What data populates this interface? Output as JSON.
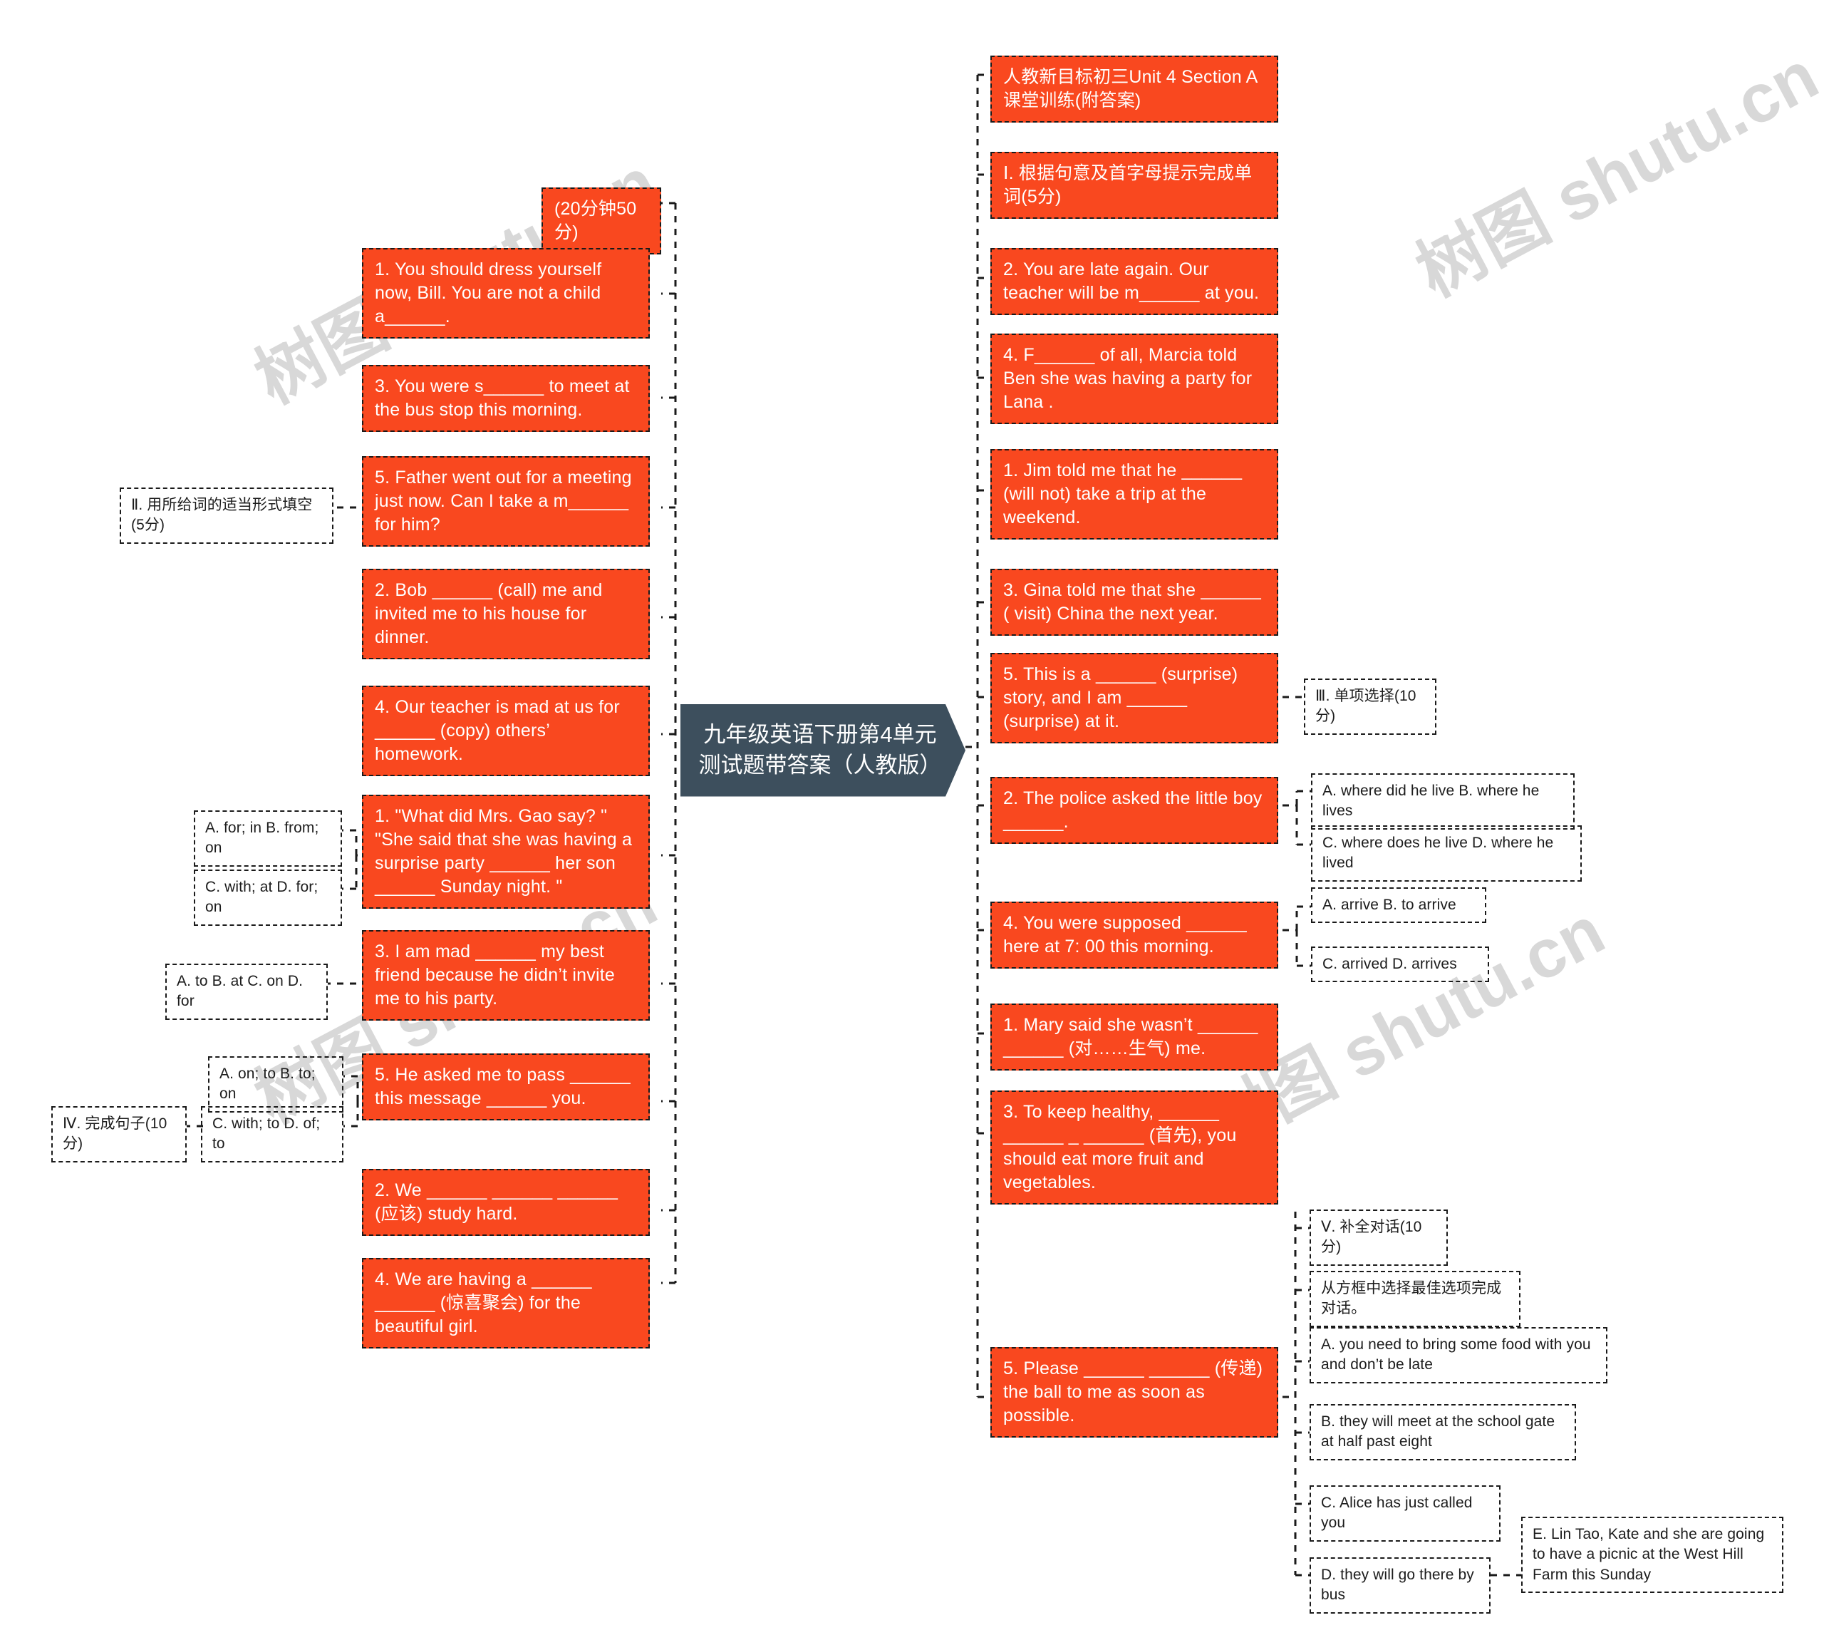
{
  "meta": {
    "accent_color": "#f9481f",
    "root_color": "#3d4f5d",
    "border_color": "#1a1a1a",
    "watermark_text_en": "shutu.cn",
    "watermark_text_cn": "树图"
  },
  "root": {
    "label": "九年级英语下册第4单元测试题带答案（人教版）"
  },
  "branches": {
    "right": [
      {
        "id": "r-title",
        "label": "人教新目标初三Unit 4 Section A课堂训练(附答案)"
      },
      {
        "id": "r-sec1",
        "label": "Ⅰ. 根据句意及首字母提示完成单词(5分)"
      },
      {
        "id": "r-q2",
        "label": "2. You are late again. Our teacher will be m______ at you."
      },
      {
        "id": "r-q4",
        "label": "4. F______ of all, Marcia told Ben she was having a party for Lana ."
      },
      {
        "id": "r-q1jim",
        "label": "1. Jim told me that he ______ (will not) take a trip at the weekend."
      },
      {
        "id": "r-q3gina",
        "label": "3. Gina told me that she ______ ( visit) China the next year."
      },
      {
        "id": "r-q5surp",
        "label": "5. This is a ______ (surprise) story, and I am ______ (surprise) at it."
      },
      {
        "id": "r-q2pol",
        "label": "2. The police asked the little boy ______."
      },
      {
        "id": "r-q4sup",
        "label": "4. You were supposed ______ here at 7: 00 this morning."
      },
      {
        "id": "r-q1mary",
        "label": "1. Mary said she wasn’t ______ ______ (对……生气) me."
      },
      {
        "id": "r-q3keep",
        "label": "3. To keep healthy, ______ ______ _ ______ (首先), you should eat more fruit and vegetables."
      },
      {
        "id": "r-q5plz",
        "label": "5. Please ______ ______ (传递) the ball to me as soon as possible."
      }
    ],
    "right_tags": [
      {
        "id": "t-sec3",
        "label": "Ⅲ. 单项选择(10分)"
      },
      {
        "id": "t-ab-live",
        "label": "A. where did he live B. where he lives"
      },
      {
        "id": "t-cd-live",
        "label": "C. where does he live D. where he lived"
      },
      {
        "id": "t-ab-arr",
        "label": "A. arrive B. to arrive"
      },
      {
        "id": "t-cd-arr",
        "label": "C. arrived D. arrives"
      },
      {
        "id": "t-sec5",
        "label": "Ⅴ. 补全对话(10分)"
      },
      {
        "id": "t-dlg",
        "label": "从方框中选择最佳选项完成对话。"
      },
      {
        "id": "t-opt-a",
        "label": "A. you need to bring some food with you and don’t be late"
      },
      {
        "id": "t-opt-b",
        "label": "B. they will meet at the school gate at half past eight"
      },
      {
        "id": "t-opt-c",
        "label": "C. Alice has just called you"
      },
      {
        "id": "t-opt-d",
        "label": "D. they will go there by bus"
      },
      {
        "id": "t-opt-e",
        "label": "E. Lin Tao, Kate and she are going to have a picnic at the West Hill Farm this Sunday"
      }
    ],
    "left": [
      {
        "id": "l-time",
        "label": "(20分钟50分)"
      },
      {
        "id": "l-q1",
        "label": "1. You should dress yourself now, Bill. You are not a child a______."
      },
      {
        "id": "l-q3",
        "label": "3. You were s______ to meet at the bus stop this morning."
      },
      {
        "id": "l-q5",
        "label": "5. Father went out for a meeting just now. Can I take a m______ for him?"
      },
      {
        "id": "l-q2bob",
        "label": "2. Bob ______ (call) me and invited me to his house for dinner."
      },
      {
        "id": "l-q4tea",
        "label": "4. Our teacher is mad at us for ______ (copy) others’ homework."
      },
      {
        "id": "l-q1gao",
        "label": "1. \"What did Mrs. Gao say? \" \"She said that she was having a surprise party ______ her son ______ Sunday night. \""
      },
      {
        "id": "l-q3mad",
        "label": "3. I am mad ______ my best friend because he didn’t invite me to his party."
      },
      {
        "id": "l-q5pass",
        "label": "5. He asked me to pass ______ this message ______ you."
      },
      {
        "id": "l-q2we",
        "label": "2. We ______ ______ ______ (应该) study hard."
      },
      {
        "id": "l-q4have",
        "label": "4. We are having a ______ ______ (惊喜聚会) for the beautiful girl."
      }
    ],
    "left_tags": [
      {
        "id": "t-sec2",
        "label": "Ⅱ. 用所给词的适当形式填空(5分)"
      },
      {
        "id": "t-ab-for",
        "label": "A. for; in B. from; on"
      },
      {
        "id": "t-cd-with",
        "label": "C. with; at D. for; on"
      },
      {
        "id": "t-abcd-to",
        "label": "A. to B. at C. on D. for"
      },
      {
        "id": "t-ab-onto",
        "label": "A. on; to B. to; on"
      },
      {
        "id": "t-cd-with2",
        "label": "C. with; to D. of; to"
      },
      {
        "id": "t-sec4",
        "label": "Ⅳ. 完成句子(10分)"
      }
    ]
  }
}
